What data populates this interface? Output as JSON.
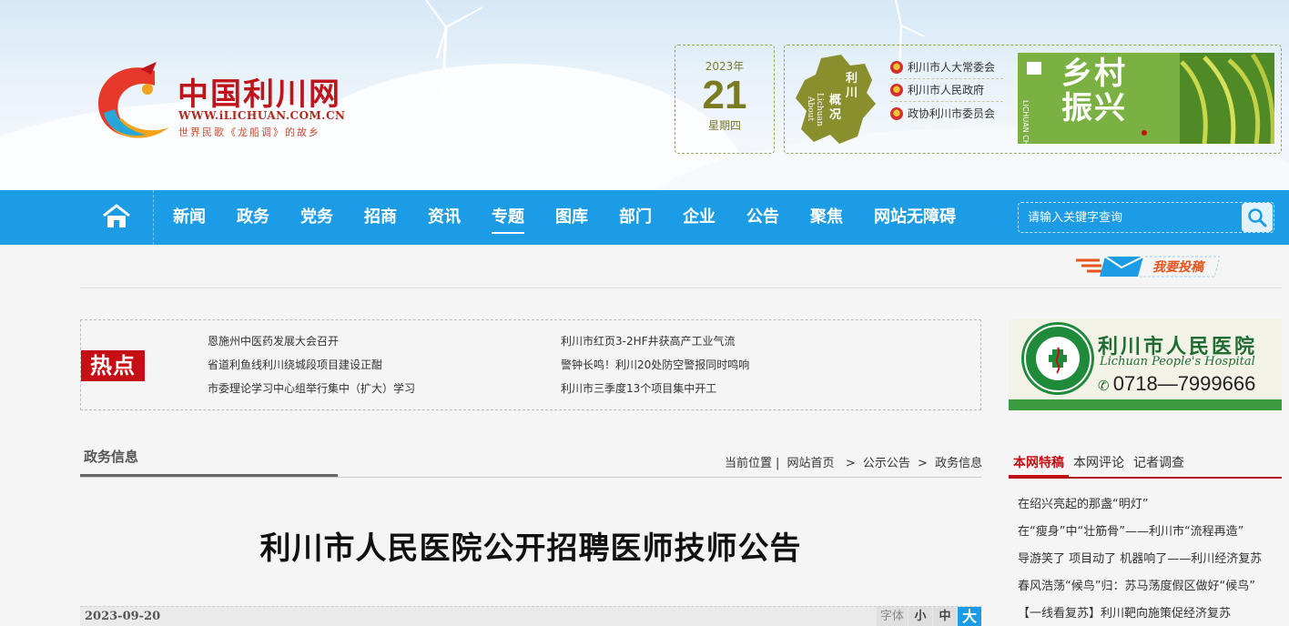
{
  "site": {
    "logo_title": "中国利川网",
    "logo_url": "WWW.iLICHUAN.COM.CN",
    "logo_slogan": "世界民歌《龙船调》的故乡"
  },
  "date": {
    "year": "2023年",
    "day": "21",
    "weekday": "星期四"
  },
  "about": {
    "map_text_cn": "利川概况",
    "map_text_en": "About Lichuan",
    "links": [
      "利川市人大常委会",
      "利川市人民政府",
      "政协利川市委员会"
    ],
    "rural_banner_text": "乡村振兴"
  },
  "nav": {
    "items": [
      "新闻",
      "政务",
      "党务",
      "招商",
      "资讯",
      "专题",
      "图库",
      "部门",
      "企业",
      "公告",
      "聚焦",
      "网站无障碍"
    ],
    "active": "专题",
    "search_placeholder": "请输入关键字查询"
  },
  "submit_label": "我要投稿",
  "hot": {
    "tag": "热点",
    "left": [
      "恩施州中医药发展大会召开",
      "省道利鱼线利川绕城段项目建设正酣",
      "市委理论学习中心组举行集中（扩大）学习"
    ],
    "right": [
      "利川市红页3-2HF井获高产工业气流",
      "警钟长鸣！利川20处防空警报同时鸣响",
      "利川市三季度13个项目集中开工"
    ]
  },
  "hospital": {
    "name": "利川市人民医院",
    "name_en": "Lichuan People's Hospital",
    "phone": "0718—7999666"
  },
  "section": {
    "title": "政务信息",
    "breadcrumb_label": "当前位置",
    "breadcrumb": [
      "网站首页",
      "公示公告",
      "政务信息"
    ]
  },
  "article": {
    "title": "利川市人民医院公开招聘医师技师公告",
    "date": "2023-09-20",
    "font_label": "字体",
    "font_sizes": [
      "小",
      "中",
      "大"
    ]
  },
  "side": {
    "tabs": [
      "本网特稿",
      "本网评论",
      "记者调查"
    ],
    "items": [
      "在绍兴亮起的那盏“明灯”",
      "在“瘦身”中“壮筋骨”——利川市“流程再造”",
      "导游笑了 项目动了 机器响了——利川经济复苏",
      "春风浩荡“候鸟”归：苏马荡度假区做好“候鸟”",
      "【一线看复苏】利川靶向施策促经济复苏"
    ]
  },
  "colors": {
    "nav": "#1c9ce4",
    "accent_red": "#c50f15",
    "olive": "#7b7b22"
  }
}
